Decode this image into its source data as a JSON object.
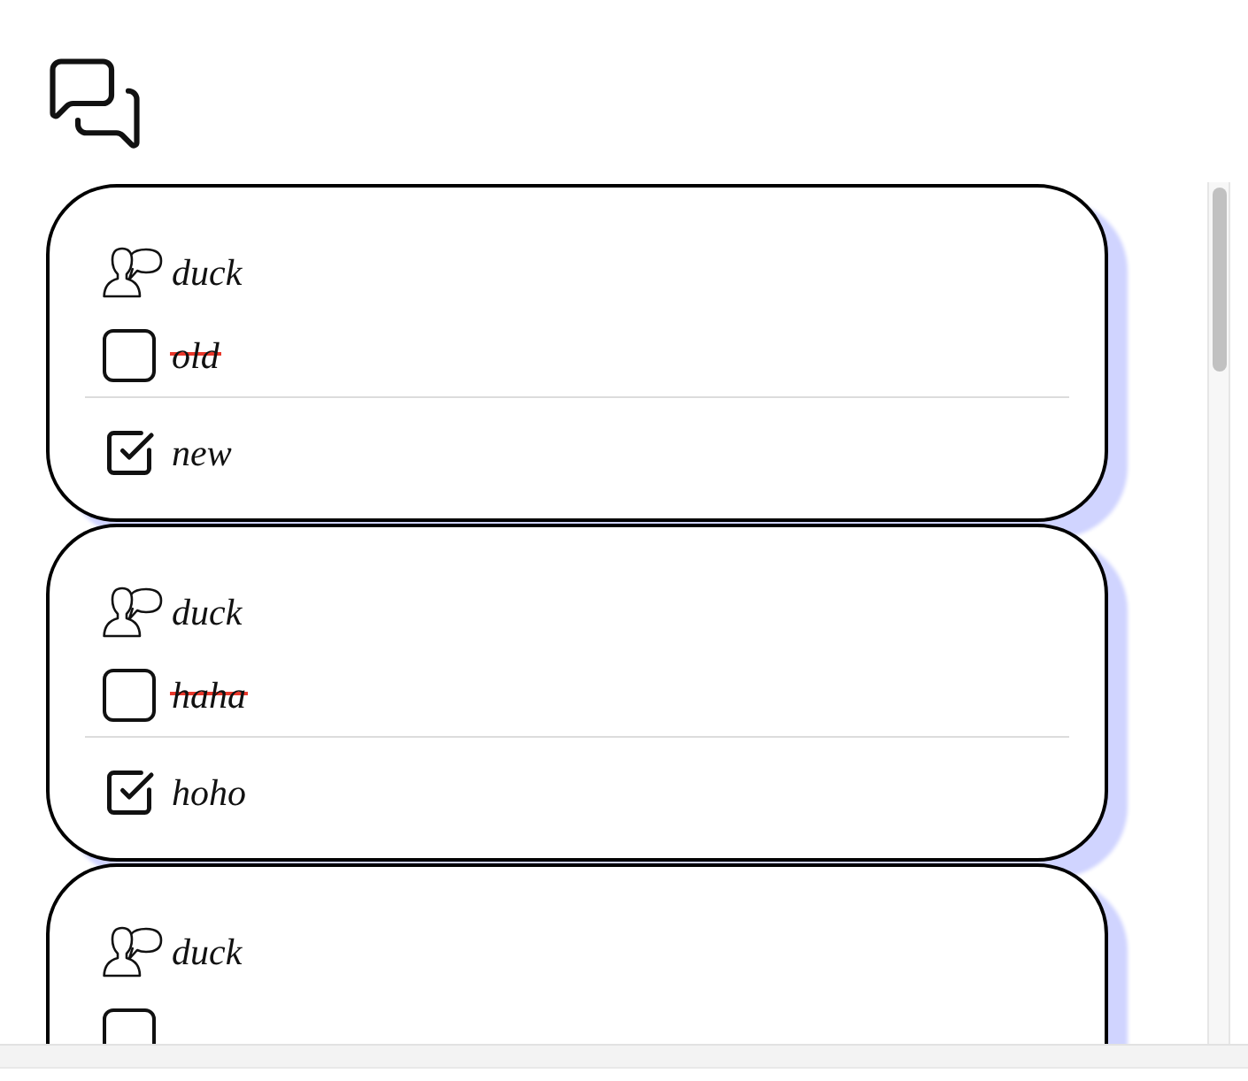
{
  "cards": [
    {
      "author": "duck",
      "options": [
        {
          "label": "old",
          "checked": false,
          "struck": true
        },
        {
          "label": "new",
          "checked": true,
          "struck": false
        }
      ]
    },
    {
      "author": "duck",
      "options": [
        {
          "label": "haha",
          "checked": false,
          "struck": true
        },
        {
          "label": "hoho",
          "checked": true,
          "struck": false
        }
      ]
    },
    {
      "author": "duck",
      "options": [
        {
          "checked": false
        }
      ]
    }
  ]
}
